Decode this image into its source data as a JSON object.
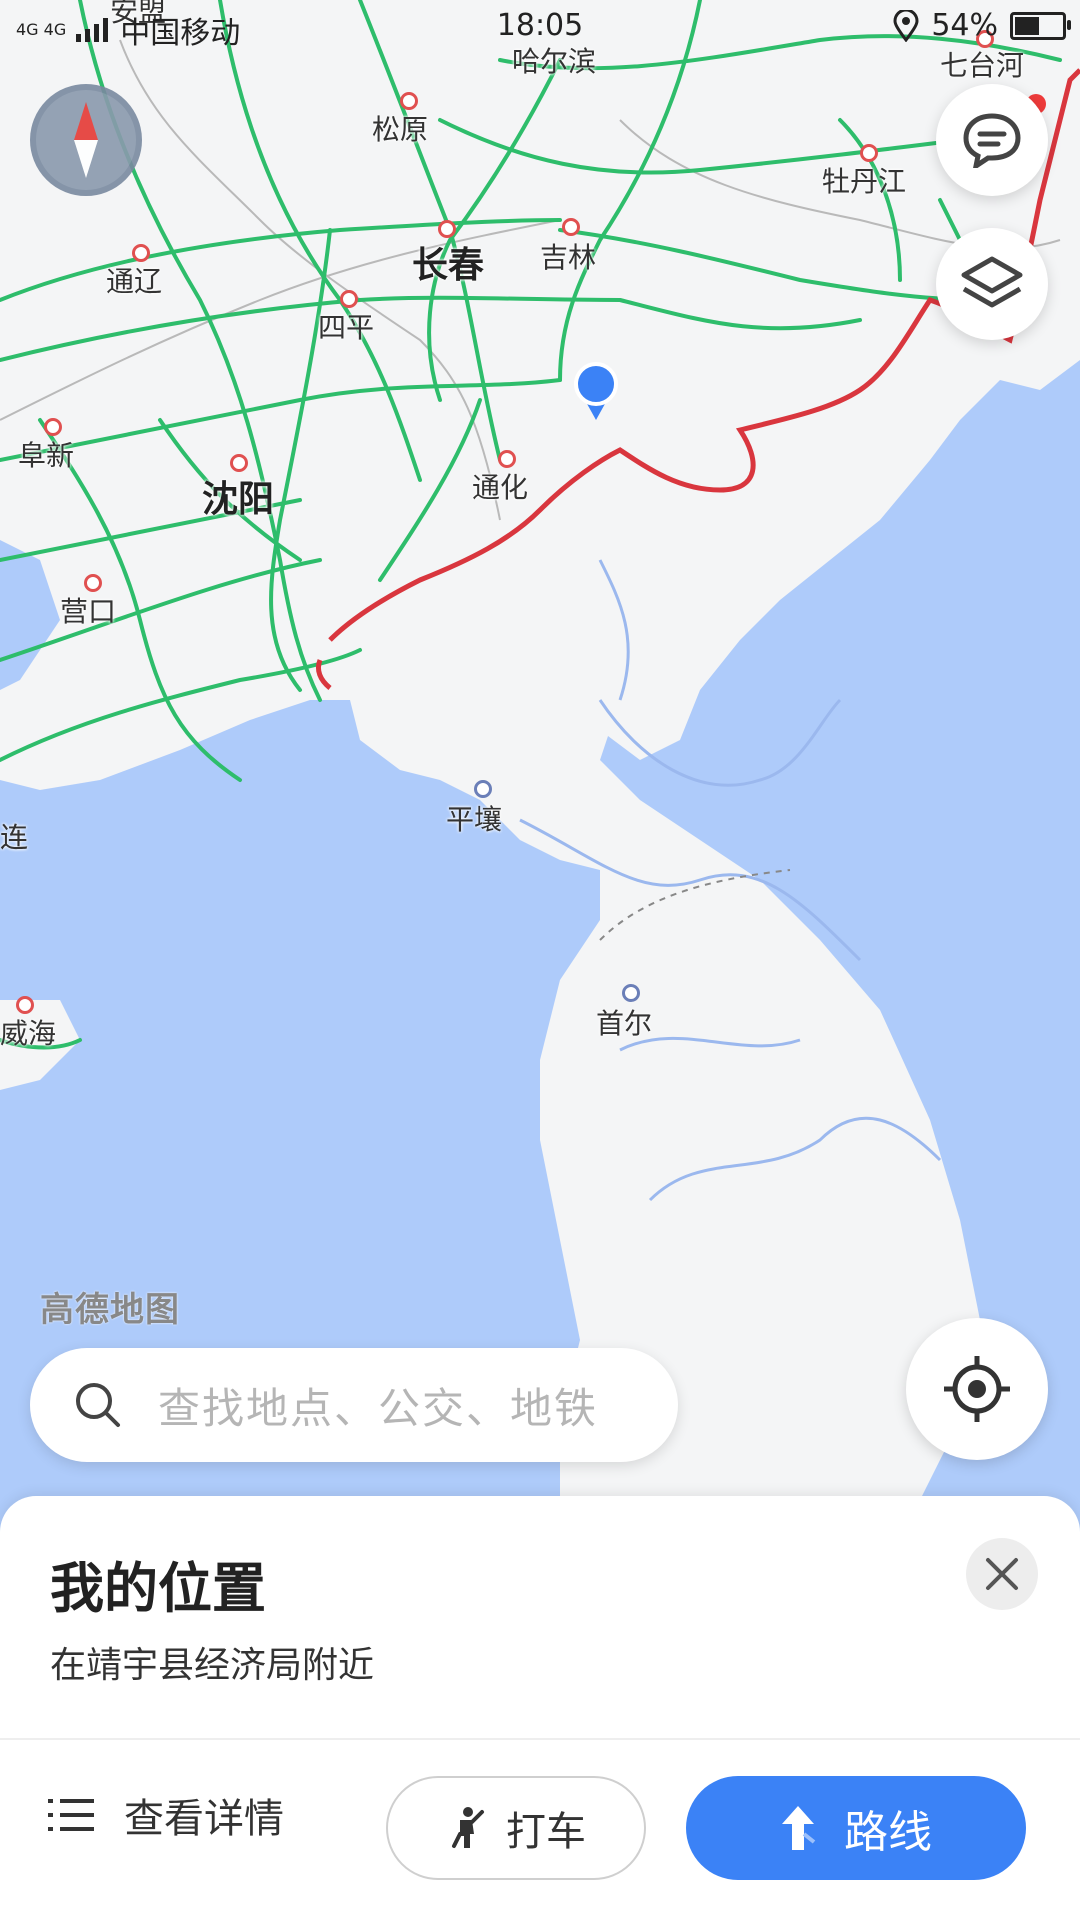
{
  "status_bar": {
    "network": "4G 4G",
    "carrier": "中国移动",
    "time": "18:05",
    "battery": "54%",
    "battery_level": 0.54
  },
  "map": {
    "watermark": "高德地图",
    "cities": [
      {
        "name": "哈尔滨",
        "big": false
      },
      {
        "name": "七台河",
        "big": false
      },
      {
        "name": "松原",
        "big": false
      },
      {
        "name": "牡丹江",
        "big": false
      },
      {
        "name": "长春",
        "big": true
      },
      {
        "name": "吉林",
        "big": false
      },
      {
        "name": "通辽",
        "big": false
      },
      {
        "name": "四平",
        "big": false
      },
      {
        "name": "阜新",
        "big": false
      },
      {
        "name": "沈阳",
        "big": true
      },
      {
        "name": "通化",
        "big": false
      },
      {
        "name": "营口",
        "big": false
      },
      {
        "name": "平壤",
        "big": false
      },
      {
        "name": "首尔",
        "big": false
      },
      {
        "name": "连",
        "big": false
      },
      {
        "name": "威海",
        "big": false
      },
      {
        "name": "安盟",
        "big": false
      }
    ],
    "icons": {
      "compass": "compass-icon",
      "message": "message-icon",
      "layers": "layers-icon",
      "locate": "locate-icon",
      "marker": "location-marker-icon"
    }
  },
  "search": {
    "placeholder": "查找地点、公交、地铁"
  },
  "sheet": {
    "title": "我的位置",
    "subtitle": "在靖宇县经济局附近",
    "details_label": "查看详情",
    "taxi_label": "打车",
    "route_label": "路线"
  },
  "colors": {
    "accent": "#3b82f6",
    "border_line": "#d9363e",
    "roads": "#2ebd6b",
    "sea": "#aecbfa",
    "land": "#f5f5f6"
  }
}
